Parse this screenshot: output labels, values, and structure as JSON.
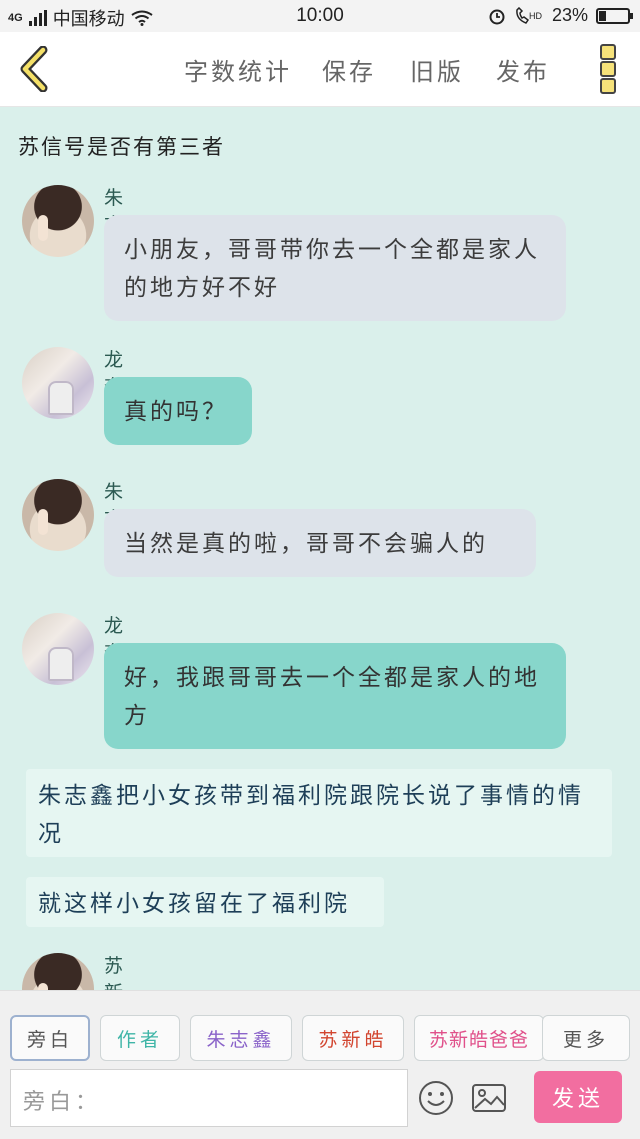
{
  "status_bar": {
    "network": "4G",
    "carrier": "中国移动",
    "time": "10:00",
    "battery_text": "23%",
    "battery_level": 0.23
  },
  "toolbar": {
    "word_count": "字数统计",
    "save": "保存",
    "old_version": "旧版",
    "publish": "发布"
  },
  "story": {
    "title": "苏信号是否有第三者",
    "messages": [
      {
        "speaker": "朱志鑫",
        "text": "小朋友，哥哥带你去一个全都是家人的地方好不好",
        "style": "gray"
      },
      {
        "speaker": "龙奎",
        "text": "真的吗？",
        "style": "teal"
      },
      {
        "speaker": "朱志鑫",
        "text": "当然是真的啦，哥哥不会骗人的",
        "style": "gray"
      },
      {
        "speaker": "龙奎",
        "text": "好，我跟哥哥去一个全都是家人的地方",
        "style": "teal"
      }
    ],
    "narrations": [
      "朱志鑫把小女孩带到福利院跟院长说了事情的情况",
      "就这样小女孩留在了福利院"
    ],
    "last_speaker": "苏新皓"
  },
  "role_chips": [
    {
      "label": "旁白",
      "color": "#555555"
    },
    {
      "label": "作者",
      "color": "#3fb5a7"
    },
    {
      "label": "朱志鑫",
      "color": "#8a63c9"
    },
    {
      "label": "苏新皓",
      "color": "#d2452f"
    },
    {
      "label": "苏新皓爸爸",
      "color": "#e0508a"
    },
    {
      "label": "更多",
      "color": "#555555"
    }
  ],
  "composer": {
    "placeholder": "旁白：",
    "send": "发送"
  },
  "colors": {
    "background": "#daf0eb",
    "bubble_gray": "#dde3ea",
    "bubble_teal": "#87d6cb",
    "send_button": "#f26ea0"
  }
}
